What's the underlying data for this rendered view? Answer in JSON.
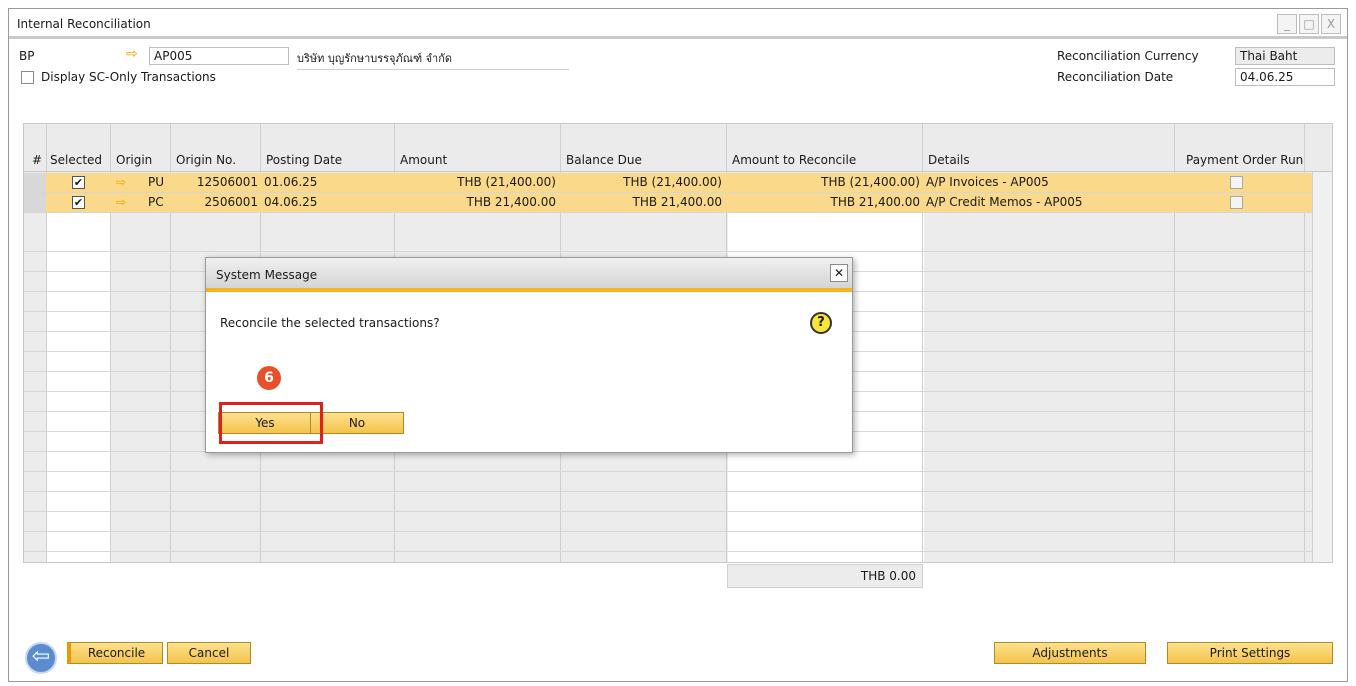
{
  "window": {
    "title": "Internal Reconciliation",
    "buttons": [
      "_",
      "□",
      "X"
    ]
  },
  "header": {
    "bp_label": "BP",
    "bp_code": "AP005",
    "bp_name": "บริษัท บุญรักษาบรรจุภัณฑ์ จำกัด",
    "display_sc_label": "Display SC-Only Transactions",
    "recon_currency_label": "Reconciliation Currency",
    "recon_currency_value": "Thai Baht",
    "recon_date_label": "Reconciliation Date",
    "recon_date_value": "04.06.25"
  },
  "table": {
    "columns": [
      "#",
      "Selected",
      "Origin",
      "Origin No.",
      "Posting Date",
      "Amount",
      "Balance Due",
      "Amount to Reconcile",
      "Details",
      "Payment Order Run"
    ],
    "rows": [
      {
        "selected": "✔",
        "origin": "PU",
        "origin_no": "12506001",
        "posting_date": "01.06.25",
        "amount": "THB (21,400.00)",
        "balance_due": "THB (21,400.00)",
        "to_reconcile": "THB (21,400.00)",
        "details": "A/P Invoices - AP005"
      },
      {
        "selected": "✔",
        "origin": "PC",
        "origin_no": "2506001",
        "posting_date": "04.06.25",
        "amount": "THB 21,400.00",
        "balance_due": "THB 21,400.00",
        "to_reconcile": "THB 21,400.00",
        "details": "A/P Credit Memos - AP005"
      }
    ],
    "total": "THB 0.00"
  },
  "dialog": {
    "title": "System Message",
    "message": "Reconcile the selected transactions?",
    "yes_label": "Yes",
    "no_label": "No",
    "step_badge": "6"
  },
  "footer": {
    "reconcile_label": "Reconcile",
    "cancel_label": "Cancel",
    "adjustments_label": "Adjustments",
    "print_settings_label": "Print Settings"
  }
}
